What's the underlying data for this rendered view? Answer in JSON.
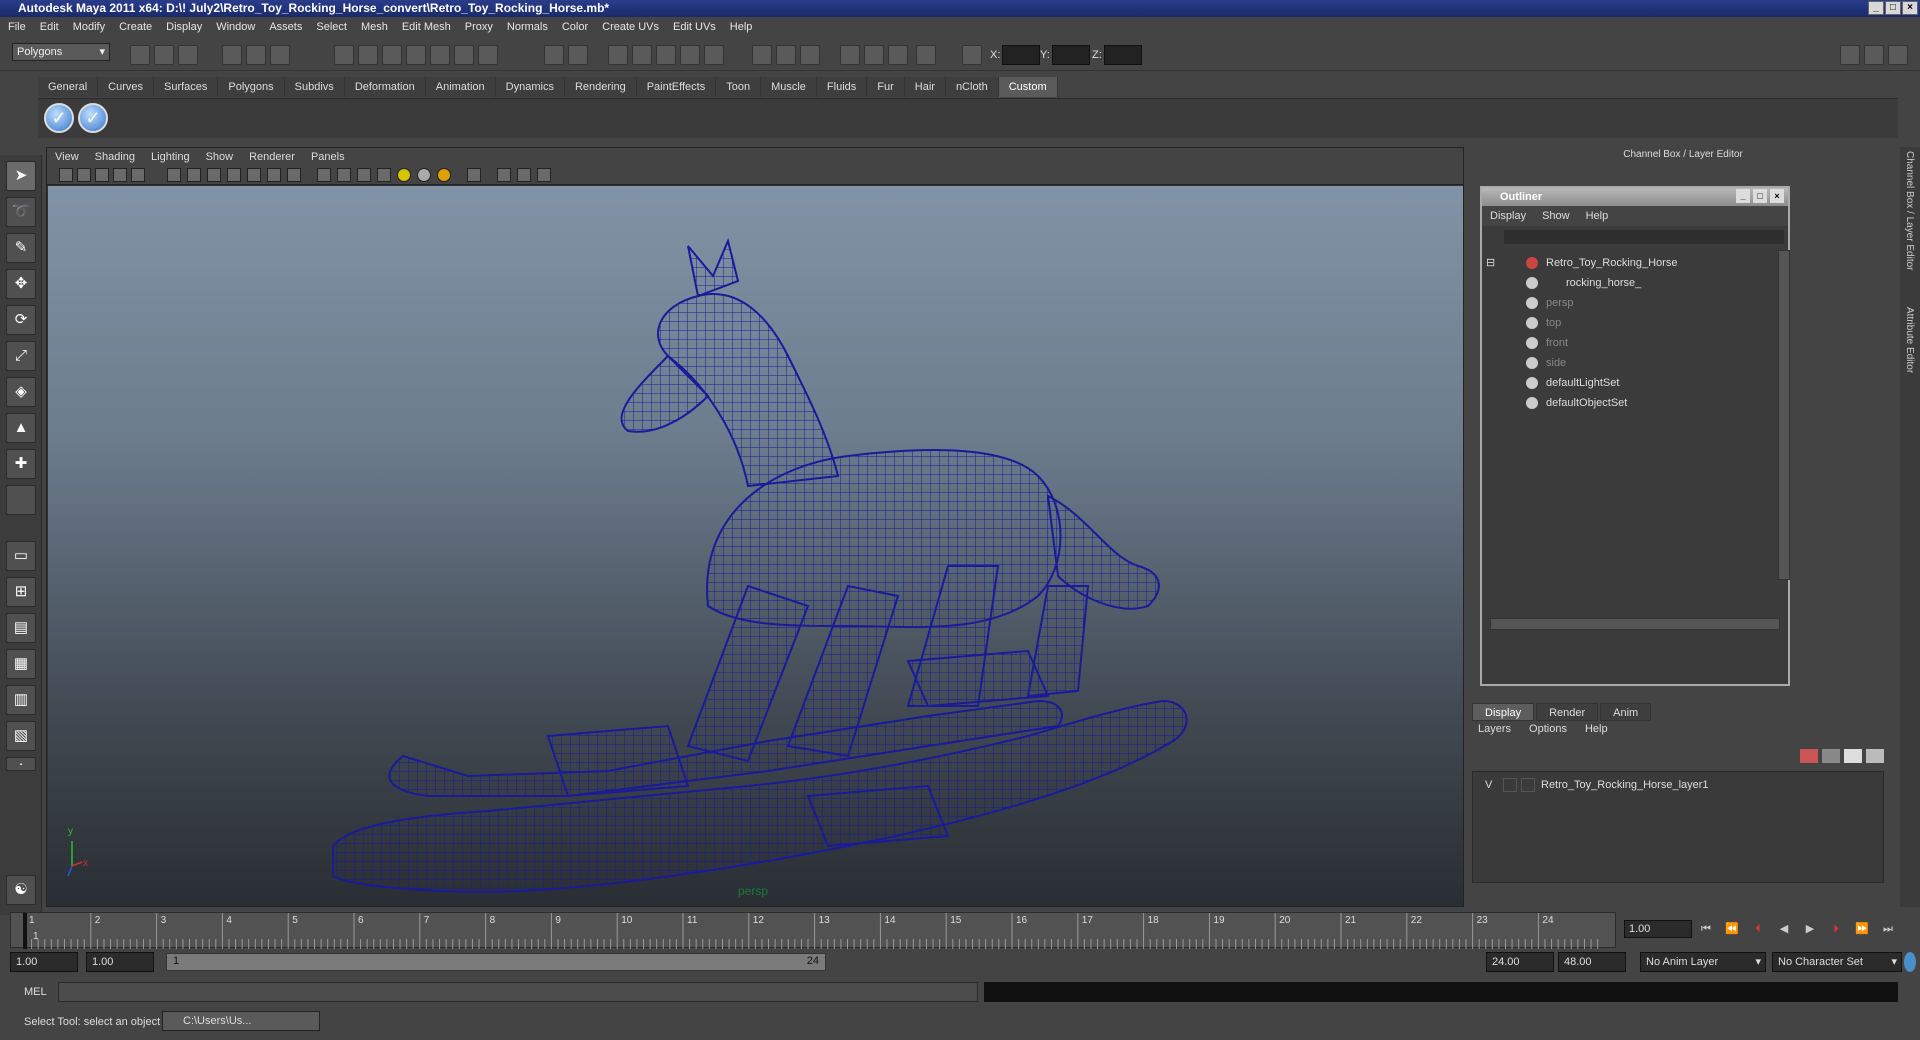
{
  "window": {
    "title": "Autodesk Maya 2011 x64: D:\\! July2\\Retro_Toy_Rocking_Horse_convert\\Retro_Toy_Rocking_Horse.mb*"
  },
  "menubar": [
    "File",
    "Edit",
    "Modify",
    "Create",
    "Display",
    "Window",
    "Assets",
    "Select",
    "Mesh",
    "Edit Mesh",
    "Proxy",
    "Normals",
    "Color",
    "Create UVs",
    "Edit UVs",
    "Help"
  ],
  "statusline": {
    "mode": "Polygons",
    "coords": {
      "x_label": "X:",
      "y_label": "Y:",
      "z_label": "Z:"
    }
  },
  "shelf": {
    "tabs": [
      "General",
      "Curves",
      "Surfaces",
      "Polygons",
      "Subdivs",
      "Deformation",
      "Animation",
      "Dynamics",
      "Rendering",
      "PaintEffects",
      "Toon",
      "Muscle",
      "Fluids",
      "Fur",
      "Hair",
      "nCloth",
      "Custom"
    ],
    "active_tab": "Custom",
    "icons": [
      "check-icon",
      "check-icon"
    ]
  },
  "viewport": {
    "menu": [
      "View",
      "Shading",
      "Lighting",
      "Show",
      "Renderer",
      "Panels"
    ],
    "camera_label": "persp",
    "axis": {
      "y": "y",
      "x": "x"
    }
  },
  "right_panel": {
    "title": "Channel Box / Layer Editor",
    "side_tabs": [
      "Channel Box / Layer Editor",
      "Attribute Editor"
    ]
  },
  "outliner": {
    "title": "Outliner",
    "menu": [
      "Display",
      "Show",
      "Help"
    ],
    "items": [
      {
        "label": "Retro_Toy_Rocking_Horse",
        "indent": 0,
        "dim": false
      },
      {
        "label": "rocking_horse_",
        "indent": 1,
        "dim": false
      },
      {
        "label": "persp",
        "indent": 0,
        "dim": true
      },
      {
        "label": "top",
        "indent": 0,
        "dim": true
      },
      {
        "label": "front",
        "indent": 0,
        "dim": true
      },
      {
        "label": "side",
        "indent": 0,
        "dim": true
      },
      {
        "label": "defaultLightSet",
        "indent": 0,
        "dim": false
      },
      {
        "label": "defaultObjectSet",
        "indent": 0,
        "dim": false
      }
    ]
  },
  "layer_editor": {
    "tabs": [
      "Display",
      "Render",
      "Anim"
    ],
    "active_tab": "Display",
    "menu": [
      "Layers",
      "Options",
      "Help"
    ],
    "layers": [
      {
        "visible": "V",
        "name": "Retro_Toy_Rocking_Horse_layer1"
      }
    ]
  },
  "timeline": {
    "frames": [
      "1",
      "2",
      "3",
      "4",
      "5",
      "6",
      "7",
      "8",
      "9",
      "10",
      "11",
      "12",
      "13",
      "14",
      "15",
      "16",
      "17",
      "18",
      "19",
      "20",
      "21",
      "22",
      "23",
      "24"
    ],
    "current_frame_marker": "1",
    "current_frame": "1.00",
    "range_start": "1.00",
    "playback_start": "1.00",
    "slider_start": "1",
    "slider_end": "24",
    "playback_end": "24.00",
    "range_end": "48.00",
    "anim_layer": "No Anim Layer",
    "character_set": "No Character Set"
  },
  "command_line": {
    "label": "MEL"
  },
  "help_line": {
    "text": "Select Tool: select an object",
    "task_item": "C:\\Users\\Us..."
  }
}
